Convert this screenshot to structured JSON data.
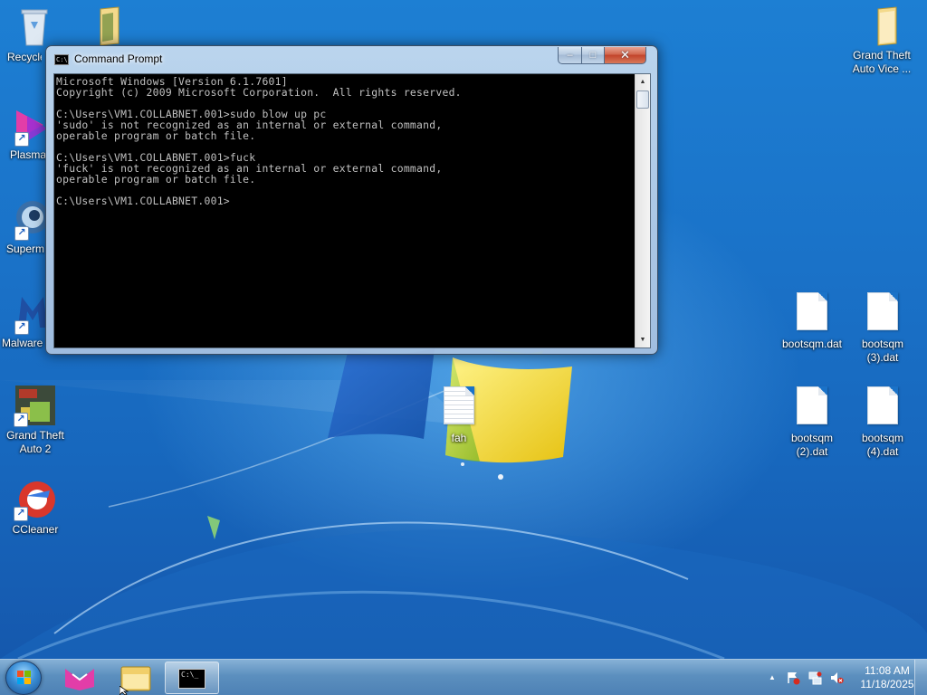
{
  "desktop": {
    "icons_left": [
      {
        "label": "Recycle Bin",
        "icon": "recycle-bin-icon"
      },
      {
        "label": "",
        "icon": "folder-icon"
      },
      {
        "label": "Plasma",
        "icon": "plasma-icon"
      },
      {
        "label": "Superm",
        "icon": "superman-game-icon"
      },
      {
        "label": "Malware",
        "icon": "malwarebytes-icon"
      },
      {
        "label": "Grand Theft Auto 2",
        "icon": "gta2-icon"
      },
      {
        "label": "CCleaner",
        "icon": "ccleaner-icon"
      }
    ],
    "icons_right": [
      {
        "label": "Grand Theft Auto Vice ...",
        "icon": "folder-icon"
      },
      {
        "label": "bootsqm.dat",
        "icon": "file-icon"
      },
      {
        "label": "bootsqm (3).dat",
        "icon": "file-icon"
      },
      {
        "label": "bootsqm (2).dat",
        "icon": "file-icon"
      },
      {
        "label": "bootsqm (4).dat",
        "icon": "file-icon"
      }
    ],
    "center_icon": {
      "label": "fah",
      "icon": "text-file-icon"
    }
  },
  "window": {
    "title": "Command Prompt",
    "buttons": {
      "minimize": "–",
      "maximize": "□",
      "close": "✕"
    },
    "console_text": "Microsoft Windows [Version 6.1.7601]\nCopyright (c) 2009 Microsoft Corporation.  All rights reserved.\n\nC:\\Users\\VM1.COLLABNET.001>sudo blow up pc\n'sudo' is not recognized as an internal or external command,\noperable program or batch file.\n\nC:\\Users\\VM1.COLLABNET.001>fuck\n'fuck' is not recognized as an internal or external command,\noperable program or batch file.\n\nC:\\Users\\VM1.COLLABNET.001>"
  },
  "taskbar": {
    "cmd_icon_text": "C:\\_",
    "clock_time": "11:08 AM",
    "clock_date": "11/18/2025",
    "tray_arrow": "▲"
  },
  "colors": {
    "console_bg": "#000000",
    "console_fg": "#c0c0c0",
    "close_red": "#c2432a",
    "desktop_blue": "#1a72c8"
  }
}
